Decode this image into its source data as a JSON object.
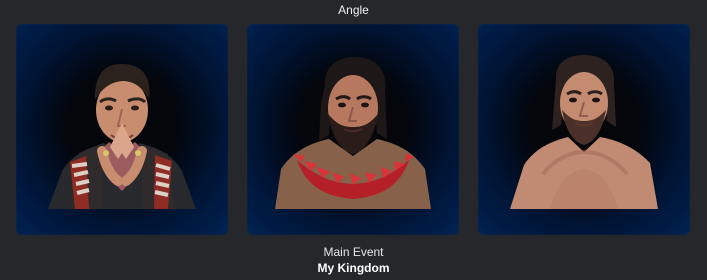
{
  "header": {
    "title": "Angle"
  },
  "cards": [
    {
      "icon": "mjf-portrait",
      "accent": "#8b1e1e"
    },
    {
      "icon": "roman-reigns-portrait",
      "accent": "#d8343c"
    },
    {
      "icon": "drew-mcintyre-portrait",
      "accent": "#b47a5e"
    }
  ],
  "footer": {
    "match_type": "Main Event",
    "event_name": "My Kingdom"
  },
  "colors": {
    "background": "#25272a",
    "card_blue": "#002252",
    "text": "#eceff3"
  }
}
